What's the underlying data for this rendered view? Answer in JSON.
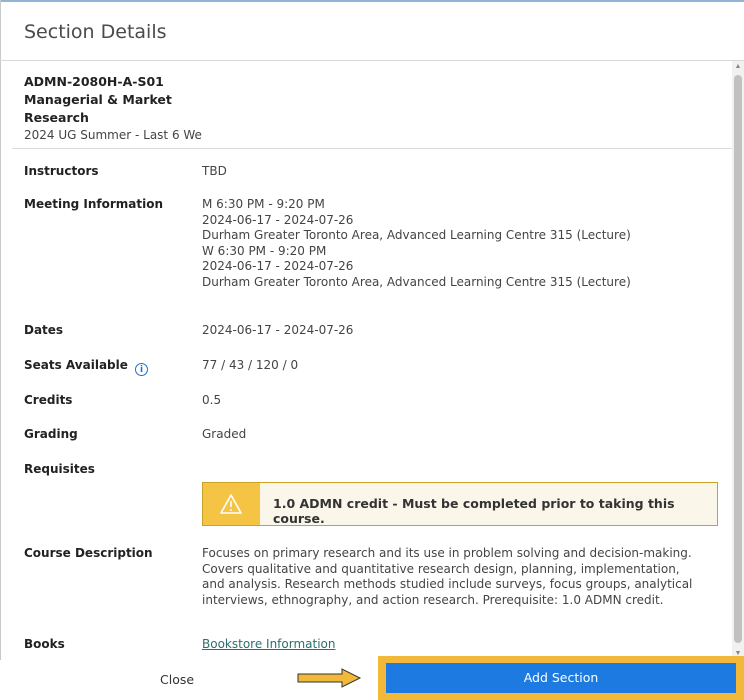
{
  "dialog": {
    "title": "Section Details"
  },
  "course": {
    "code": "ADMN-2080H-A-S01",
    "name_line1": "Managerial & Market",
    "name_line2": "Research",
    "term": "2024 UG Summer - Last 6 We"
  },
  "details": {
    "instructors": {
      "label": "Instructors",
      "value": "TBD"
    },
    "meeting": {
      "label": "Meeting Information",
      "lines": [
        "M 6:30 PM - 9:20 PM",
        "2024-06-17 - 2024-07-26",
        "Durham Greater Toronto Area, Advanced Learning Centre 315 (Lecture)",
        "W 6:30 PM - 9:20 PM",
        "2024-06-17 - 2024-07-26",
        "Durham Greater Toronto Area, Advanced Learning Centre 315 (Lecture)"
      ]
    },
    "dates": {
      "label": "Dates",
      "value": "2024-06-17 - 2024-07-26"
    },
    "seats": {
      "label": "Seats Available",
      "value": "77 / 43 / 120 / 0",
      "info_icon": "info-icon"
    },
    "credits": {
      "label": "Credits",
      "value": "0.5"
    },
    "grading": {
      "label": "Grading",
      "value": "Graded"
    },
    "requisites": {
      "label": "Requisites",
      "message": "1.0 ADMN credit - Must be completed prior to taking this course.",
      "icon": "warning-icon"
    },
    "description": {
      "label": "Course Description",
      "lines": [
        "Focuses on primary research and its use in problem solving and decision-making.",
        "Covers qualitative and quantitative research design, planning, implementation,",
        "and analysis. Research methods studied include surveys, focus groups, analytical",
        "interviews, ethnography, and action research. Prerequisite: 1.0 ADMN credit."
      ]
    },
    "books": {
      "label": "Books",
      "link": "Bookstore Information"
    }
  },
  "footer": {
    "close_label": "Close",
    "add_label": "Add Section"
  },
  "colors": {
    "accent": "#1d7ae0",
    "highlight": "#f1b83a",
    "warning": "#f5c445"
  }
}
